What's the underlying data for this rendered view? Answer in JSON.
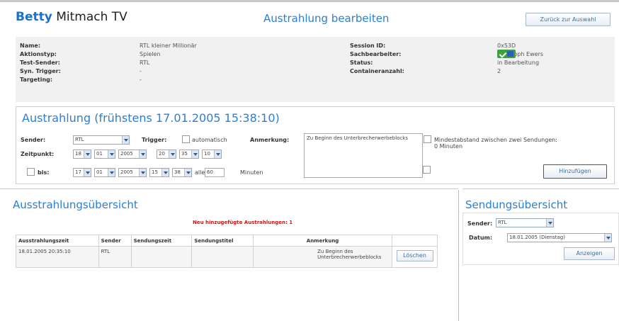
{
  "header": {
    "logo_bold": "Betty",
    "logo_rest": " Mitmach TV",
    "page_title": "Austrahlung bearbeiten",
    "back_button": "Zurück zur Auswahl"
  },
  "info": {
    "left": [
      {
        "key": "Name:",
        "value": "RTL kleiner Millionär"
      },
      {
        "key": "Aktionstyp:",
        "value": "Spielen"
      },
      {
        "key": "Test-Sender:",
        "value": "RTL"
      },
      {
        "key": "Syn. Trigger:",
        "value": "-"
      },
      {
        "key": "Targeting:",
        "value": "-"
      }
    ],
    "right": [
      {
        "key": "Session ID:",
        "value": "0x53D"
      },
      {
        "key": "Sachbearbeiter:",
        "value": "Christoph Ewers"
      },
      {
        "key": "Status:",
        "value": "in Bearbeitung"
      },
      {
        "key": "Containeranzahl:",
        "value": "2"
      }
    ],
    "targeting_icon": "check-globe-icon"
  },
  "austrahlung": {
    "title": "Austrahlung (frühstens 17.01.2005 15:38:10)",
    "sender_label": "Sender:",
    "sender_value": "RTL",
    "trigger_label": "Trigger:",
    "trigger_auto": "automatisch",
    "anmerkung_label": "Anmerkung:",
    "anmerkung_value": "Zu Beginn des Unterbrecherwerbeblocks",
    "mindestabstand": "Mindestabstand zwischen zwei Sendungen:",
    "mindestabstand_value": "0 Minuten",
    "zeitpunkt_label": "Zeitpunkt:",
    "zeit": {
      "day": "18",
      "month": "01",
      "year": "2005",
      "hour": "20",
      "minute": "35",
      "second": "10"
    },
    "bis_label": "bis:",
    "bis": {
      "day": "17",
      "month": "01",
      "year": "2005",
      "hour": "15",
      "minute": "38"
    },
    "alle_label": "alle",
    "alle_value": "60",
    "minuten_label": "Minuten",
    "add_button": "Hinzufügen"
  },
  "uebersicht": {
    "title": "Ausstrahlungsübersicht",
    "notice": "Neu hinzugefügte Austrahlungen: 1",
    "columns": [
      "Ausstrahlungszeit",
      "Sender",
      "Sendungszeit",
      "Sendungstitel",
      "Anmerkung",
      ""
    ],
    "rows": [
      {
        "zeit": "18.01.2005 20:35:10",
        "sender": "RTL",
        "sendungszeit": "",
        "titel": "",
        "anmerkung": "Zu Beginn des Unterbrecherwerbeblocks",
        "action": "Löschen"
      }
    ]
  },
  "sendungen": {
    "title": "Sendungsübersicht",
    "sender_label": "Sender:",
    "sender_value": "RTL",
    "datum_label": "Datum:",
    "datum_value": "18.01.2005 (Dienstag)",
    "show_button": "Anzeigen"
  }
}
